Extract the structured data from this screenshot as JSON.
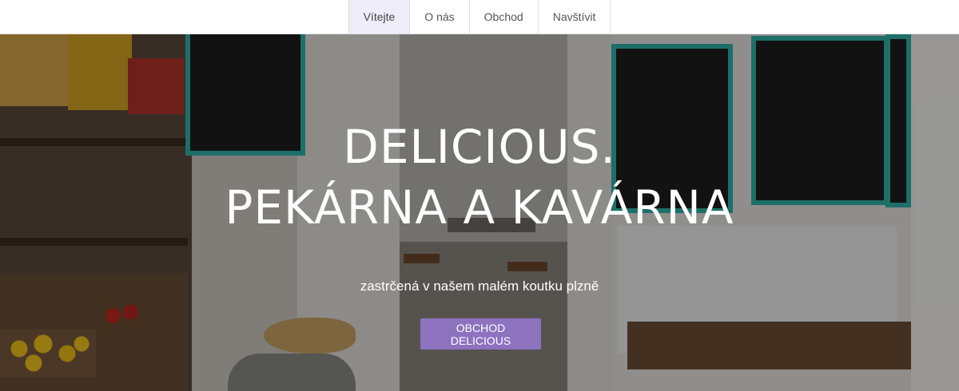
{
  "nav": {
    "items": [
      {
        "label": "Vítejte",
        "active": true
      },
      {
        "label": "O nás"
      },
      {
        "label": "Obchod"
      },
      {
        "label": "Navštívit"
      }
    ]
  },
  "hero": {
    "title_line1": "DELICIOUS.",
    "title_line2": "PEKÁRNA A KAVÁRNA",
    "subtitle": "zastrčená v našem malém koutku plzně",
    "cta_label": "OBCHOD DELICIOUS",
    "colors": {
      "cta": "#8c72bf",
      "nav_active": "#efedf9"
    }
  }
}
